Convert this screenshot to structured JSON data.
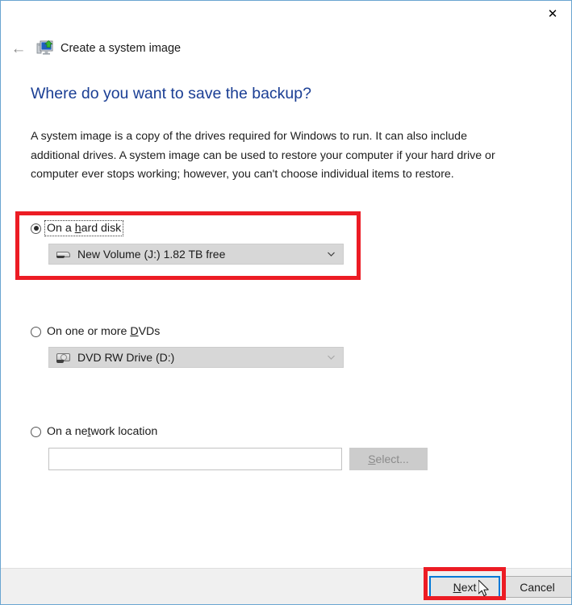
{
  "window": {
    "border_color": "#6aa5d1",
    "close_label": "✕",
    "back_label": "←",
    "app_icon": "system-image-backup-icon",
    "wizard_title": "Create a system image"
  },
  "page": {
    "heading": "Where do you want to save the backup?",
    "heading_color": "#1a3e94",
    "description": "A system image is a copy of the drives required for Windows to run. It can also include additional drives. A system image can be used to restore your computer if your hard drive or computer ever stops working; however, you can't choose individual items to restore."
  },
  "options": {
    "hard_disk": {
      "label_pre": "On a ",
      "label_accel": "h",
      "label_post": "ard disk",
      "label_full": "On a hard disk",
      "selected": true,
      "focused": true,
      "combo_icon": "hard-drive-icon",
      "combo_value": "New Volume (J:)  1.82 TB free",
      "combo_enabled": true,
      "chevron": "chevron-down-icon"
    },
    "dvd": {
      "label_pre": "On one or more ",
      "label_accel": "D",
      "label_post": "VDs",
      "label_full": "On one or more DVDs",
      "selected": false,
      "combo_icon": "dvd-drive-icon",
      "combo_value": "DVD RW Drive (D:)",
      "combo_enabled": false,
      "chevron": "chevron-down-icon"
    },
    "network": {
      "label_pre": "On a ne",
      "label_accel": "t",
      "label_post": "work location",
      "label_full": "On a network location",
      "selected": false,
      "input_value": "",
      "input_placeholder": "",
      "select_button_pre": "",
      "select_button_accel": "S",
      "select_button_post": "elect...",
      "select_button_label": "Select...",
      "select_button_enabled": false
    }
  },
  "footer": {
    "next_pre": "",
    "next_accel": "N",
    "next_post": "ext",
    "next_label": "Next",
    "cancel_label": "Cancel",
    "next_focused": true
  },
  "annotations": {
    "highlight_color": "#ec1c24",
    "focus_color": "#0078d7",
    "boxes": [
      "hard-disk-option",
      "next-button"
    ]
  }
}
